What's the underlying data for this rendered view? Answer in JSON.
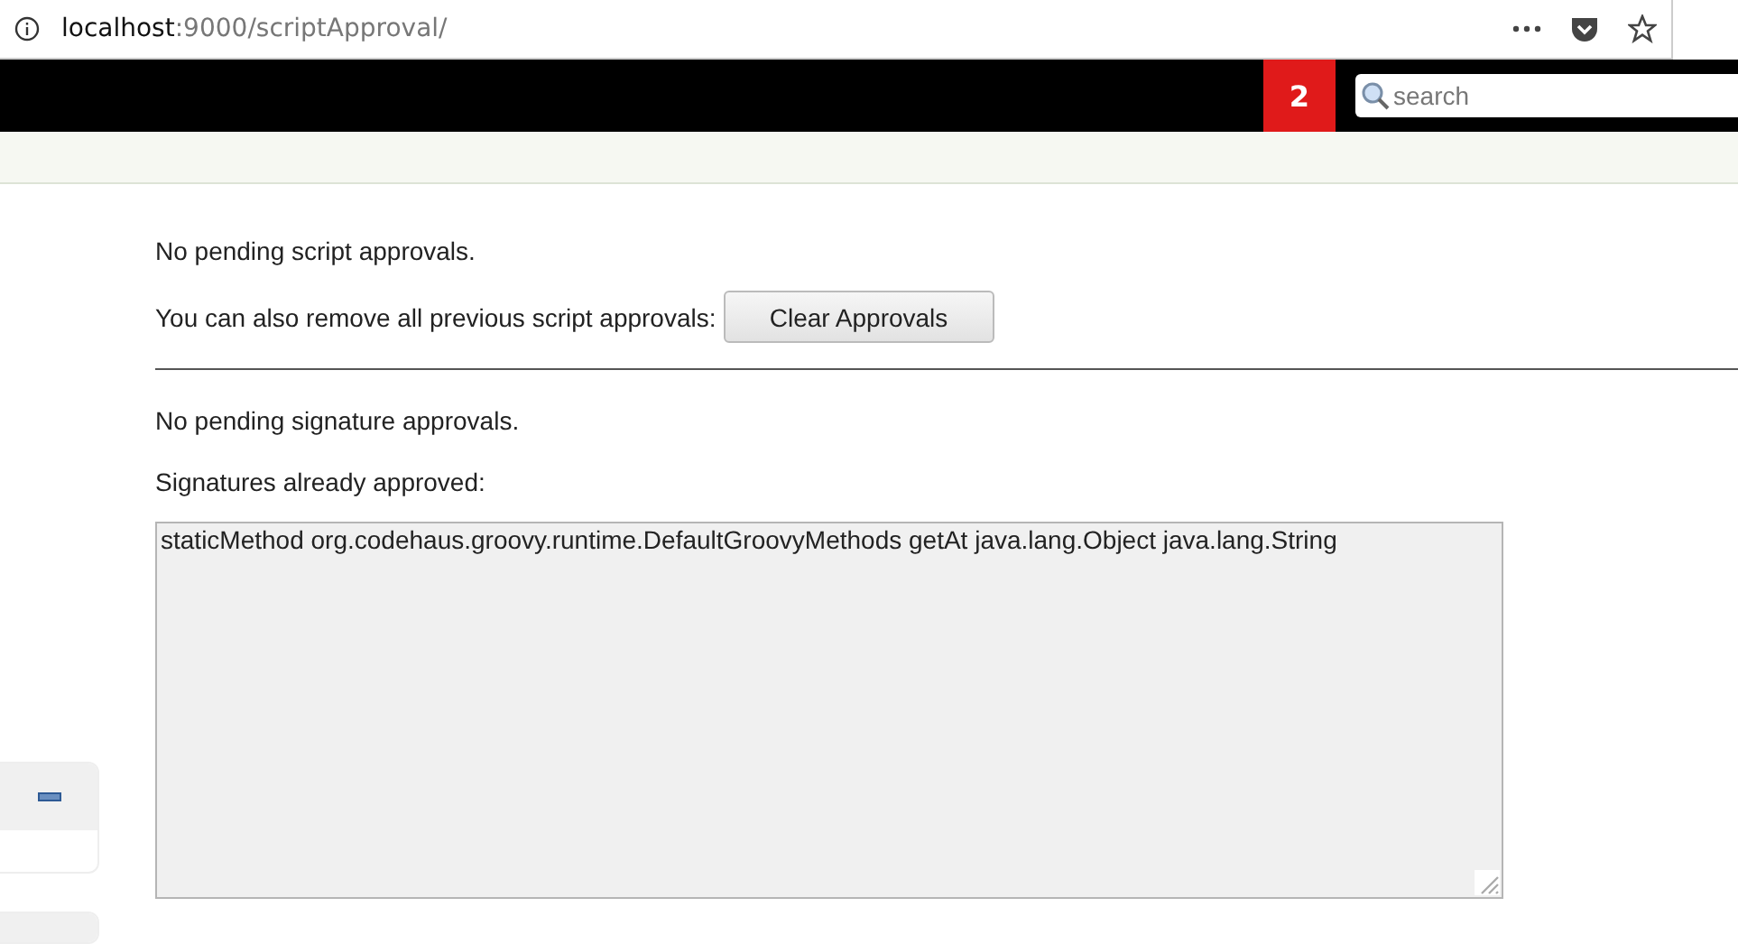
{
  "address_bar": {
    "host": "localhost",
    "path": ":9000/scriptApproval/"
  },
  "header": {
    "badge": "2",
    "search": {
      "placeholder": "search"
    }
  },
  "content": {
    "pending_scripts": "No pending script approvals.",
    "clear_label": "You can also remove all previous script approvals:",
    "clear_button": "Clear Approvals",
    "pending_signatures": "No pending signature approvals.",
    "approved_label": "Signatures already approved:",
    "approved_signatures": "staticMethod org.codehaus.groovy.runtime.DefaultGroovyMethods getAt java.lang.Object java.lang.String"
  }
}
